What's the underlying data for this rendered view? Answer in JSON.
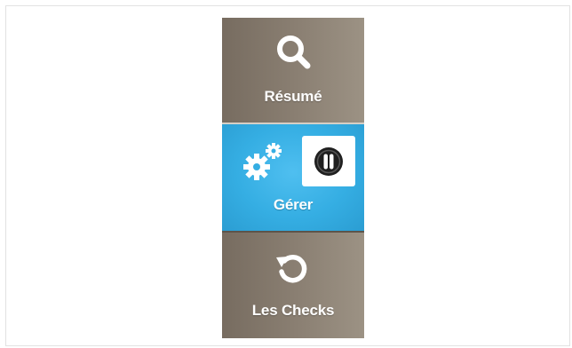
{
  "nav": {
    "items": [
      {
        "label": "Résumé",
        "icon": "search-icon",
        "active": false
      },
      {
        "label": "Gérer",
        "icon": "gears-icon",
        "active": true,
        "badge_icon": "pause-icon"
      },
      {
        "label": "Les Checks",
        "icon": "refresh-icon",
        "active": false
      }
    ]
  },
  "colors": {
    "nav_bg": "#8b8073",
    "active_bg": "#35aee3",
    "text": "#ffffff",
    "badge_bg": "#ffffff",
    "badge_icon": "#1f1f1f"
  }
}
